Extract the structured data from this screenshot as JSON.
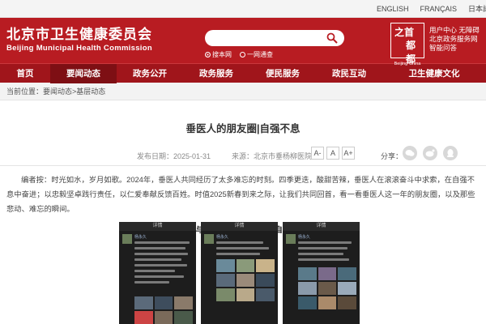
{
  "top_links": [
    "ENGLISH",
    "FRANÇAIS",
    "日本語"
  ],
  "site": {
    "name_cn": "北京市卫生健康委员会",
    "name_en": "Beijing Municipal Health Commission"
  },
  "search": {
    "placeholder": "",
    "scope_site": "搜本网",
    "scope_all": "一网通查"
  },
  "brand": {
    "top_left": "之首",
    "bottom_right": "都都",
    "caption": "Beijing·China"
  },
  "quick_links": [
    "用户中心 无障碍",
    "北京政务服务网",
    "智能问答"
  ],
  "nav": [
    "首页",
    "要闻动态",
    "政务公开",
    "政务服务",
    "便民服务",
    "政民互动",
    "卫生健康文化"
  ],
  "nav_active_index": 1,
  "breadcrumb": {
    "prefix": "当前位置：",
    "level1": "要闻动态",
    "separator": ">",
    "level2": "基层动态"
  },
  "article": {
    "title": "垂医人的朋友圈|自强不息",
    "date": "发布日期：2025-01-31",
    "source": "来源：北京市垂杨柳医院",
    "font_buttons": [
      "A-",
      "A",
      "A+"
    ],
    "share_label": "分享：",
    "share_icons": [
      "wechat-icon",
      "weibo-icon",
      "qq-icon"
    ],
    "intro": "编者按：时光如水，岁月如歌。2024年，垂医人共同经历了太多难忘的时刻。四季更迭，酸甜苦辣，垂医人在滚滚奋斗中求索，在自强不息中奋进；以忠毅坚卓践行责任，以仁爱奉献反馈百姓。时值2025新春到来之际，让我们共同回首，看一看垂医人这一年的朋友圈，以及那些悲动、难忘的瞬间。",
    "subheading": "介入与血管外科主任杨永久|自强不息"
  },
  "phone_shots": [
    {
      "bar": "详情",
      "name": "杨永久"
    },
    {
      "bar": "详情",
      "name": "杨永久"
    },
    {
      "bar": "详情",
      "name": "杨永久"
    }
  ],
  "colors": {
    "header_red": "#b81c22",
    "nav_red": "#a0151b",
    "nav_active": "#7e0f14"
  }
}
